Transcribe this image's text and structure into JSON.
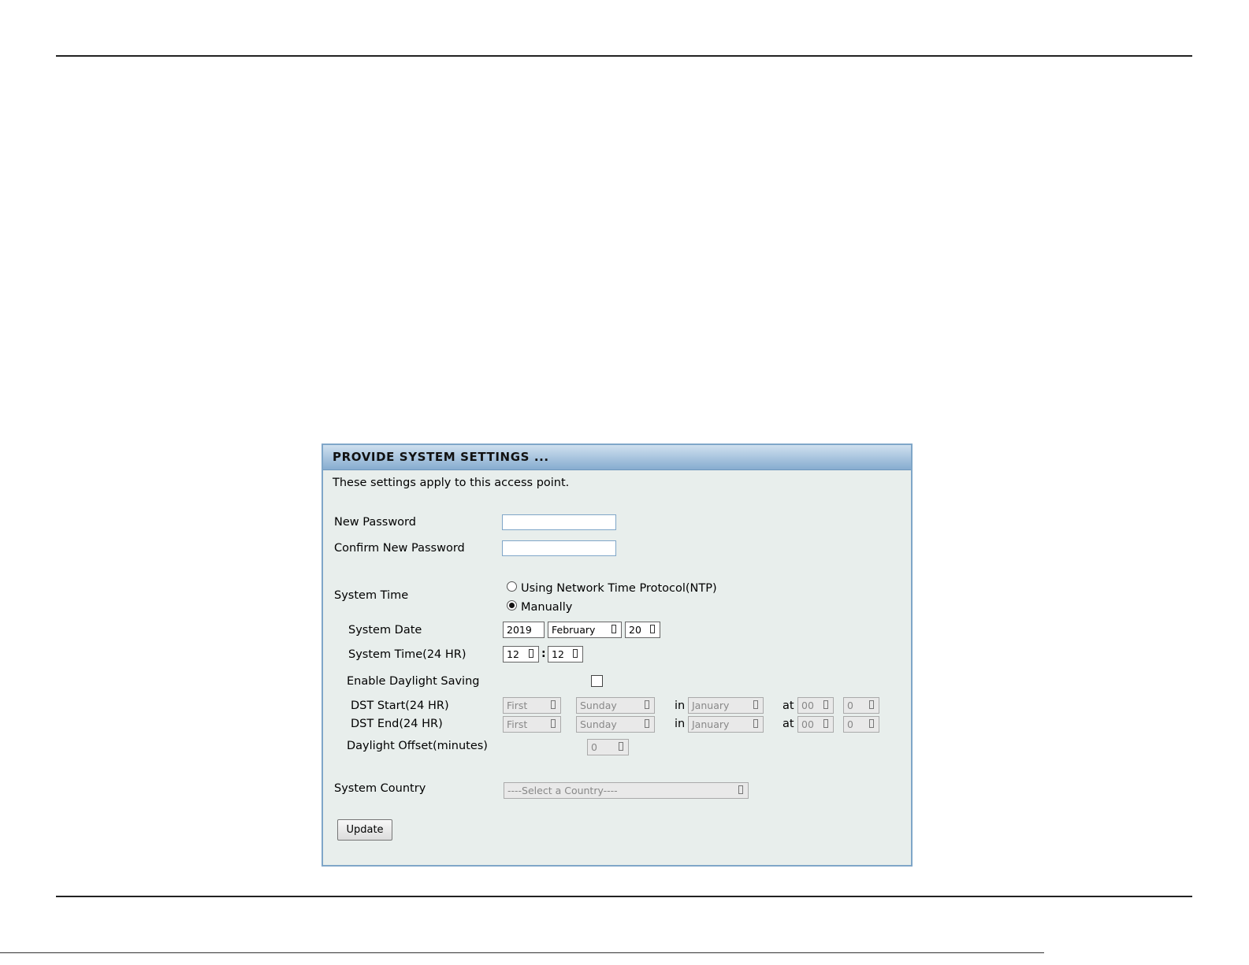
{
  "panel": {
    "title": "PROVIDE SYSTEM SETTINGS ...",
    "intro": "These settings apply to this access point."
  },
  "fields": {
    "new_password_label": "New Password",
    "confirm_password_label": "Confirm New Password",
    "system_time_label": "System Time",
    "ntp_option": "Using Network Time Protocol(NTP)",
    "manual_option": "Manually",
    "system_date_label": "System Date",
    "system_time24_label": "System Time(24 HR)",
    "daylight_label": "Enable Daylight Saving",
    "dst_start_label": "DST Start(24 HR)",
    "dst_end_label": "DST End(24 HR)",
    "offset_label": "Daylight Offset(minutes)",
    "country_label": "System Country"
  },
  "values": {
    "year": "2019",
    "month": "February",
    "day": "20",
    "hour": "12",
    "minute": "12",
    "time_separator": ":",
    "dst_start": {
      "week": "First",
      "weekday": "Sunday",
      "in": "in",
      "month": "January",
      "at": "at",
      "hour": "00",
      "minute": "0"
    },
    "dst_end": {
      "week": "First",
      "weekday": "Sunday",
      "in": "in",
      "month": "January",
      "at": "at",
      "hour": "00",
      "minute": "0"
    },
    "offset": "0",
    "country": "----Select a Country----"
  },
  "state": {
    "time_mode": "manual",
    "daylight_saving_enabled": false
  },
  "buttons": {
    "update": "Update"
  }
}
